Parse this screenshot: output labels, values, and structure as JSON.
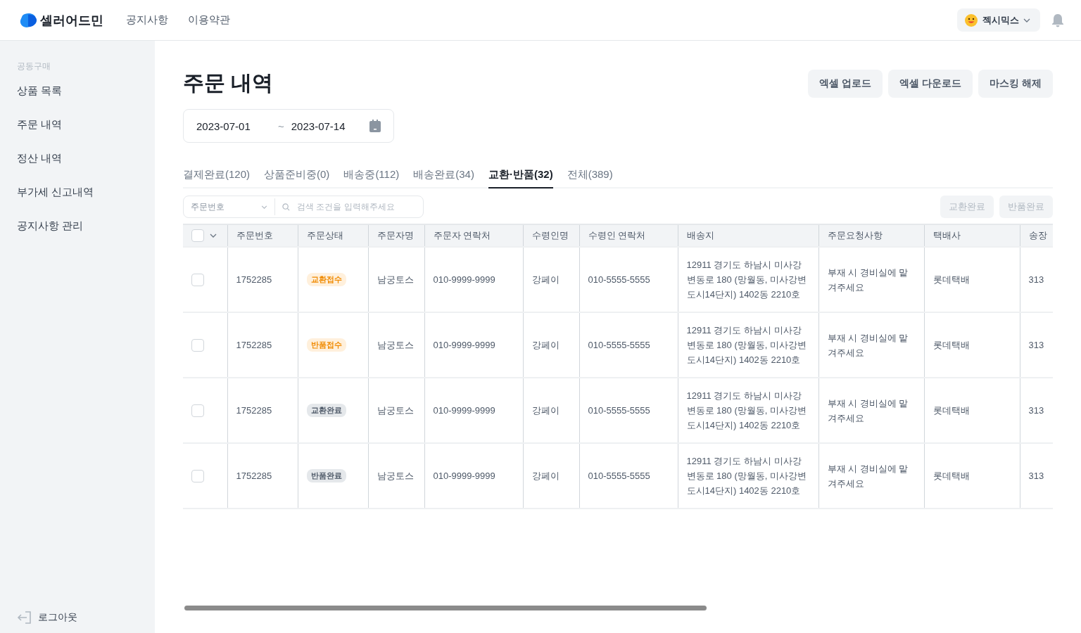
{
  "header": {
    "logo": "셀러어드민",
    "nav": [
      "공지사항",
      "이용약관"
    ],
    "user": {
      "name": "젝시믹스"
    }
  },
  "sidebar": {
    "section": "공동구매",
    "items": [
      {
        "label": "상품 목록",
        "selected": false
      },
      {
        "label": "주문 내역",
        "selected": false
      },
      {
        "label": "정산 내역",
        "selected": false
      },
      {
        "label": "부가세 신고내역",
        "selected": false
      },
      {
        "label": "공지사항 관리",
        "selected": false
      }
    ],
    "logout": "로그아웃"
  },
  "page": {
    "title": "주문 내역",
    "buttons": [
      "엑셀 업로드",
      "엑셀 다운로드",
      "마스킹 해제"
    ]
  },
  "date_range": {
    "from": "2023-07-01",
    "separator": "~",
    "to": "2023-07-14"
  },
  "tabs": [
    {
      "label": "결제완료(120)",
      "selected": false
    },
    {
      "label": "상품준비중(0)",
      "selected": false
    },
    {
      "label": "배송중(112)",
      "selected": false
    },
    {
      "label": "배송완료(34)",
      "selected": false
    },
    {
      "label": "교환·반품(32)",
      "selected": true
    },
    {
      "label": "전체(389)",
      "selected": false
    }
  ],
  "filter": {
    "field": "주문번호",
    "placeholder": "검색 조건을 입력해주세요"
  },
  "actions": [
    {
      "label": "교환완료",
      "disabled": true
    },
    {
      "label": "반품완료",
      "disabled": true
    }
  ],
  "table": {
    "select_all_checked": false,
    "columns": [
      "주문번호",
      "주문상태",
      "주문자명",
      "주문자 연락처",
      "수령인명",
      "수령인 연락처",
      "배송지",
      "주문요청사항",
      "택배사",
      "송장"
    ],
    "rows": [
      {
        "checked": false,
        "order_no": "1752285",
        "status": {
          "label": "교환접수",
          "kind": "pending"
        },
        "orderer": "남궁토스",
        "orderer_phone": "010-9999-9999",
        "recipient": "강페이",
        "recipient_phone": "010-5555-5555",
        "address": "12911 경기도 하남시 미사강변동로 180 (망월동, 미사강변도시14단지) 1402동 2210호",
        "request": "부재 시 경비실에 맡겨주세요",
        "courier": "롯데택배",
        "invoice": "313"
      },
      {
        "checked": false,
        "order_no": "1752285",
        "status": {
          "label": "반품접수",
          "kind": "pending"
        },
        "orderer": "남궁토스",
        "orderer_phone": "010-9999-9999",
        "recipient": "강페이",
        "recipient_phone": "010-5555-5555",
        "address": "12911 경기도 하남시 미사강변동로 180 (망월동, 미사강변도시14단지) 1402동 2210호",
        "request": "부재 시 경비실에 맡겨주세요",
        "courier": "롯데택배",
        "invoice": "313"
      },
      {
        "checked": false,
        "order_no": "1752285",
        "status": {
          "label": "교환완료",
          "kind": "done"
        },
        "orderer": "남궁토스",
        "orderer_phone": "010-9999-9999",
        "recipient": "강페이",
        "recipient_phone": "010-5555-5555",
        "address": "12911 경기도 하남시 미사강변동로 180 (망월동, 미사강변도시14단지) 1402동 2210호",
        "request": "부재 시 경비실에 맡겨주세요",
        "courier": "롯데택배",
        "invoice": "313"
      },
      {
        "checked": false,
        "order_no": "1752285",
        "status": {
          "label": "반품완료",
          "kind": "done"
        },
        "orderer": "남궁토스",
        "orderer_phone": "010-9999-9999",
        "recipient": "강페이",
        "recipient_phone": "010-5555-5555",
        "address": "12911 경기도 하남시 미사강변동로 180 (망월동, 미사강변도시14단지) 1402동 2210호",
        "request": "부재 시 경비실에 맡겨주세요",
        "courier": "롯데택배",
        "invoice": "313"
      }
    ]
  }
}
